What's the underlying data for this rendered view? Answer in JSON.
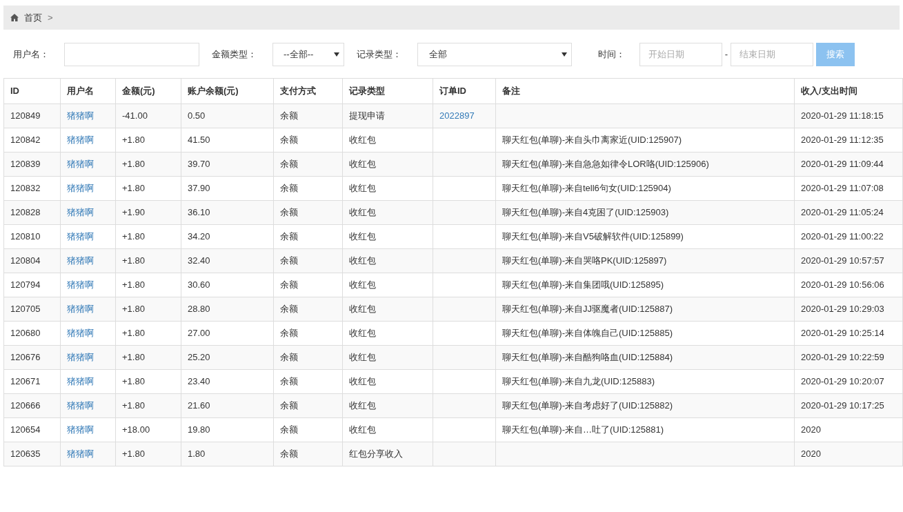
{
  "breadcrumb": {
    "items": [
      "首页"
    ],
    "separator": ">"
  },
  "filters": {
    "username": {
      "label": "用户名："
    },
    "amount_type": {
      "label": "金额类型：",
      "value": "--全部--"
    },
    "record_type": {
      "label": "记录类型：",
      "value": "全部"
    },
    "time": {
      "label": "时间：",
      "start_placeholder": "开始日期",
      "separator": "-",
      "end_placeholder": "结束日期"
    },
    "search_button": "搜索"
  },
  "table": {
    "columns": [
      "ID",
      "用户名",
      "金额(元)",
      "账户余额(元)",
      "支付方式",
      "记录类型",
      "订单ID",
      "备注",
      "收入/支出时间"
    ],
    "rows": [
      [
        "120849",
        "猪猪啊",
        "-41.00",
        "0.50",
        "余额",
        "提现申请",
        "2022897",
        "",
        "2020-01-29 11:18:15"
      ],
      [
        "120842",
        "猪猪啊",
        "+1.80",
        "41.50",
        "余额",
        "收红包",
        "",
        "聊天红包(单聊)-来自头巾离家近(UID:125907)",
        "2020-01-29 11:12:35"
      ],
      [
        "120839",
        "猪猪啊",
        "+1.80",
        "39.70",
        "余额",
        "收红包",
        "",
        "聊天红包(单聊)-来自急急如律令LOR咯(UID:125906)",
        "2020-01-29 11:09:44"
      ],
      [
        "120832",
        "猪猪啊",
        "+1.80",
        "37.90",
        "余额",
        "收红包",
        "",
        "聊天红包(单聊)-来自tell6句女(UID:125904)",
        "2020-01-29 11:07:08"
      ],
      [
        "120828",
        "猪猪啊",
        "+1.90",
        "36.10",
        "余额",
        "收红包",
        "",
        "聊天红包(单聊)-来自4克困了(UID:125903)",
        "2020-01-29 11:05:24"
      ],
      [
        "120810",
        "猪猪啊",
        "+1.80",
        "34.20",
        "余额",
        "收红包",
        "",
        "聊天红包(单聊)-来自V5破解软件(UID:125899)",
        "2020-01-29 11:00:22"
      ],
      [
        "120804",
        "猪猪啊",
        "+1.80",
        "32.40",
        "余额",
        "收红包",
        "",
        "聊天红包(单聊)-来自哭咯PK(UID:125897)",
        "2020-01-29 10:57:57"
      ],
      [
        "120794",
        "猪猪啊",
        "+1.80",
        "30.60",
        "余额",
        "收红包",
        "",
        "聊天红包(单聊)-来自集团哦(UID:125895)",
        "2020-01-29 10:56:06"
      ],
      [
        "120705",
        "猪猪啊",
        "+1.80",
        "28.80",
        "余额",
        "收红包",
        "",
        "聊天红包(单聊)-来自JJ驱魔者(UID:125887)",
        "2020-01-29 10:29:03"
      ],
      [
        "120680",
        "猪猪啊",
        "+1.80",
        "27.00",
        "余额",
        "收红包",
        "",
        "聊天红包(单聊)-来自体魄自己(UID:125885)",
        "2020-01-29 10:25:14"
      ],
      [
        "120676",
        "猪猪啊",
        "+1.80",
        "25.20",
        "余额",
        "收红包",
        "",
        "聊天红包(单聊)-来自酷狗咯血(UID:125884)",
        "2020-01-29 10:22:59"
      ],
      [
        "120671",
        "猪猪啊",
        "+1.80",
        "23.40",
        "余额",
        "收红包",
        "",
        "聊天红包(单聊)-来自九龙(UID:125883)",
        "2020-01-29 10:20:07"
      ],
      [
        "120666",
        "猪猪啊",
        "+1.80",
        "21.60",
        "余额",
        "收红包",
        "",
        "聊天红包(单聊)-来自考虑好了(UID:125882)",
        "2020-01-29 10:17:25"
      ],
      [
        "120654",
        "猪猪啊",
        "+18.00",
        "19.80",
        "余额",
        "收红包",
        "",
        "聊天红包(单聊)-来自…吐了(UID:125881)",
        "2020"
      ],
      [
        "120635",
        "猪猪啊",
        "+1.80",
        "1.80",
        "余额",
        "红包分享收入",
        "",
        "",
        "2020"
      ]
    ]
  }
}
